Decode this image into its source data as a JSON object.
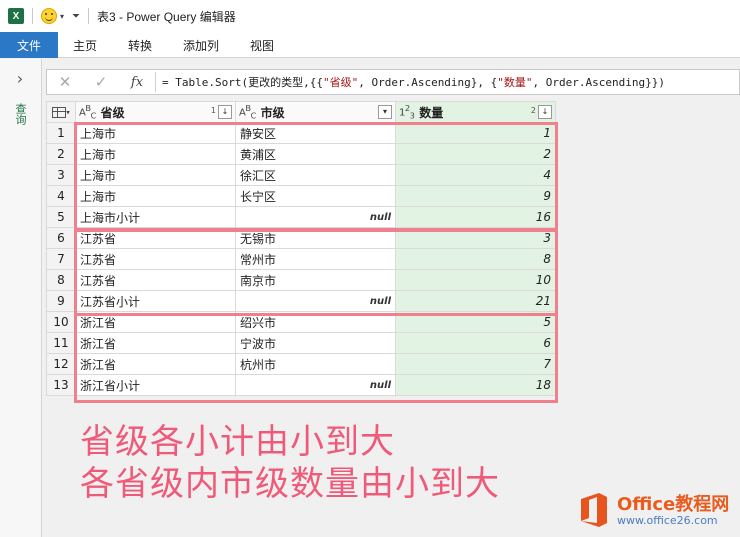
{
  "window": {
    "title": "表3 - Power Query 编辑器"
  },
  "ribbon": {
    "tabs": [
      "文件",
      "主页",
      "转换",
      "添加列",
      "视图"
    ]
  },
  "leftpane": {
    "queries_label": "查询"
  },
  "formula_bar": {
    "fx": "fx",
    "formula_prefix": "= Table.Sort(更改的类型,{{",
    "str1": "\"省级\"",
    "mid": ", Order.Ascending}, {",
    "str2": "\"数量\"",
    "suffix": ", Order.Ascending}})"
  },
  "grid": {
    "columns": [
      {
        "name": "省级",
        "type_icon": "ABC",
        "sort_index": "1"
      },
      {
        "name": "市级",
        "type_icon": "ABC",
        "sort_index": ""
      },
      {
        "name": "数量",
        "type_icon": "123",
        "sort_index": "2"
      }
    ],
    "rows": [
      {
        "n": "1",
        "prov": "上海市",
        "city": "静安区",
        "qty": "1"
      },
      {
        "n": "2",
        "prov": "上海市",
        "city": "黄浦区",
        "qty": "2"
      },
      {
        "n": "3",
        "prov": "上海市",
        "city": "徐汇区",
        "qty": "4"
      },
      {
        "n": "4",
        "prov": "上海市",
        "city": "长宁区",
        "qty": "9"
      },
      {
        "n": "5",
        "prov": "上海市小计",
        "city": "null",
        "qty": "16"
      },
      {
        "n": "6",
        "prov": "江苏省",
        "city": "无锡市",
        "qty": "3"
      },
      {
        "n": "7",
        "prov": "江苏省",
        "city": "常州市",
        "qty": "8"
      },
      {
        "n": "8",
        "prov": "江苏省",
        "city": "南京市",
        "qty": "10"
      },
      {
        "n": "9",
        "prov": "江苏省小计",
        "city": "null",
        "qty": "21"
      },
      {
        "n": "10",
        "prov": "浙江省",
        "city": "绍兴市",
        "qty": "5"
      },
      {
        "n": "11",
        "prov": "浙江省",
        "city": "宁波市",
        "qty": "6"
      },
      {
        "n": "12",
        "prov": "浙江省",
        "city": "杭州市",
        "qty": "7"
      },
      {
        "n": "13",
        "prov": "浙江省小计",
        "city": "null",
        "qty": "18"
      }
    ]
  },
  "annotation": {
    "line1": "省级各小计由小到大",
    "line2": "各省级内市级数量由小到大"
  },
  "watermark": {
    "brand": "Office教程网",
    "url": "www.office26.com"
  },
  "colors": {
    "file_tab": "#2a78c6",
    "highlight": "#f0808e",
    "annotation": "#ef5a78",
    "numeric_column": "#e3f3e3"
  }
}
